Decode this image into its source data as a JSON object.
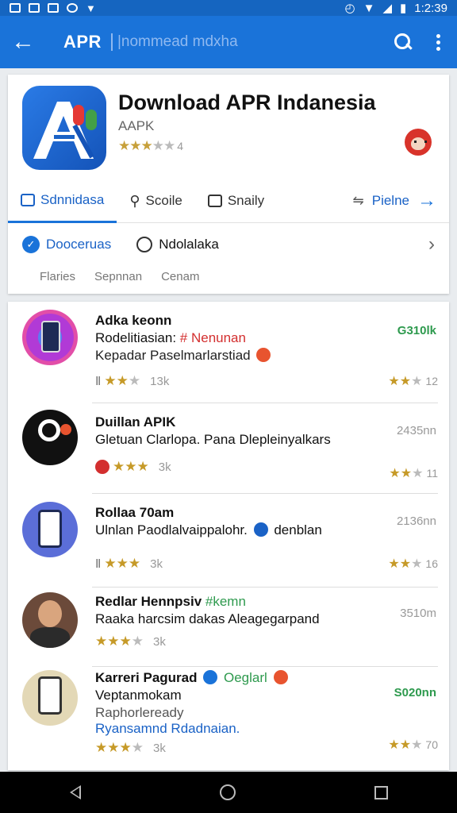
{
  "status_bar": {
    "time": "1:2:39"
  },
  "app_bar": {
    "title": "APR",
    "breadcrumb": "|nommead mdxha"
  },
  "header": {
    "app_name": "Download APR Indanesia",
    "subtitle": "AAPK",
    "stars": "★★★☆☆",
    "rating_count": "4",
    "tabs": [
      {
        "label": "Sdnnidasa",
        "icon": "chat-icon",
        "active": true
      },
      {
        "label": "Scoile",
        "icon": "search-icon",
        "active": false
      },
      {
        "label": "Snaily",
        "icon": "square-icon",
        "active": false
      }
    ],
    "share_label": "Pielne",
    "filters": [
      {
        "label": "Dooceruas",
        "icon": "check-circle-icon",
        "active": true
      },
      {
        "label": "Ndolalaka",
        "icon": "bubble-icon",
        "active": false
      }
    ],
    "sub_tabs": [
      "Flaries",
      "Sepnnan",
      "Cenam"
    ]
  },
  "items": [
    {
      "title": "Adka keonn",
      "line2_prefix": "Rodelitiasian: ",
      "line2_hash": "# Nenunan",
      "line3": "Kepadar Paselmarlarstiad",
      "stars_prefix": "Ⅱ",
      "stars": "★★☆",
      "count": "13k",
      "right": "G310lk",
      "right_stars": "★★☆",
      "right_count": "12"
    },
    {
      "title": "Duillan APIK",
      "line2": "Gletuan Clarlopa. Pana Dlepleinyalkars",
      "stars": "★★★",
      "count": "3k",
      "right": "2435nn",
      "right_stars": "★★☆",
      "right_count": "11"
    },
    {
      "title": "Rollaa 70am",
      "line2": "Ulnlan Paodlalvaippalohr.",
      "line2_suffix": "denblan",
      "stars_prefix": "Ⅱ",
      "stars": "★★★",
      "count": "3k",
      "right": "2136nn",
      "right_stars": "★★☆",
      "right_count": "16"
    },
    {
      "title": "Redlar Hennpsiv",
      "title_tag": "#kemn",
      "line2": "Raaka harcsim dakas Aleagegarpand",
      "stars": "★★★☆",
      "count": "3k",
      "right": "3510m"
    },
    {
      "title": "Karreri Pagurad",
      "title_tag": "Oeglarl",
      "line2": "Veptanmokam",
      "line3": "Raphorleready",
      "line4": "Ryansamnd Rdadnaian.",
      "stars": "★★★☆",
      "count": "3k",
      "right": "S020nn",
      "right_stars": "★★☆",
      "right_count": "70"
    }
  ],
  "colors": {
    "primary": "#1a73d9",
    "status": "#1565c0",
    "star": "#c69a28",
    "green": "#2e9a4e",
    "red": "#d32f2f"
  }
}
